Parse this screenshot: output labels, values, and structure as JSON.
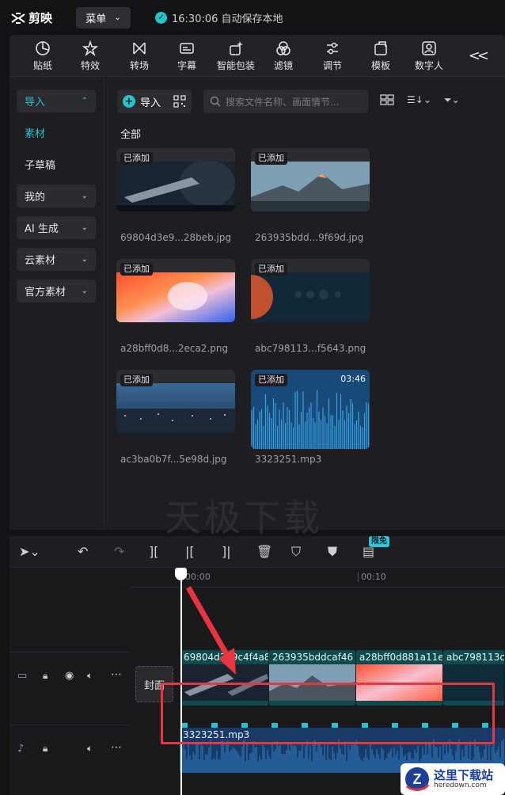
{
  "app": {
    "name": "剪映",
    "menu_label": "菜单",
    "save_status": "16:30:06 自动保存本地"
  },
  "toolbar": {
    "items": [
      "贴纸",
      "特效",
      "转场",
      "字幕",
      "智能包装",
      "滤镜",
      "调节",
      "模板",
      "数字人"
    ]
  },
  "sidebar": {
    "items": [
      {
        "label": "导入",
        "active": true
      },
      {
        "label": "素材",
        "active": true
      },
      {
        "label": "子草稿",
        "active": false
      },
      {
        "label": "我的",
        "active": false
      },
      {
        "label": "AI 生成",
        "active": false
      },
      {
        "label": "云素材",
        "active": false
      },
      {
        "label": "官方素材",
        "active": false
      }
    ]
  },
  "media": {
    "import_label": "导入",
    "search_placeholder": "搜索文件名称、画面情节...",
    "section": "全部",
    "added_badge": "已添加",
    "files": [
      {
        "name": "69804d3e9...28beb.jpg"
      },
      {
        "name": "263935bdd...9f69d.jpg"
      },
      {
        "name": "a28bff0d8...2eca2.png"
      },
      {
        "name": "abc798113...f5643.png"
      },
      {
        "name": "ac3ba0b7f...5e98d.jpg"
      },
      {
        "name": "3323251.mp3",
        "duration": "03:46"
      }
    ]
  },
  "watermark": "天极下载",
  "timeline": {
    "free_badge": "限免",
    "ruler": [
      "00:00",
      "00:10"
    ],
    "cover_label": "封面",
    "clips": [
      "69804d3e9c4f4a8",
      "263935bddcaf46",
      "a28bff0d881a11e",
      "abc798113c"
    ],
    "audio_name": "3323251.mp3"
  },
  "site_logo": {
    "title": "这里下载站",
    "url": "heredown.com"
  },
  "colors": {
    "accent": "#22c4cf",
    "highlight": "#e8353f"
  }
}
